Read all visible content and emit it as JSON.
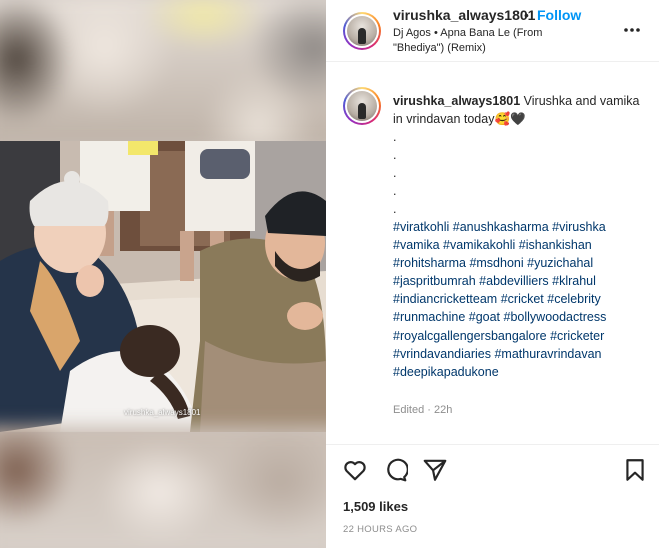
{
  "header": {
    "username": "virushka_always1801",
    "separator": "•",
    "follow_label": "Follow",
    "audio": "Dj Agos • Apna Bana Le (From \"Bhediya\") (Remix)",
    "more_icon": "more-horizontal-icon"
  },
  "media": {
    "watermark": "virushka_always1801"
  },
  "caption": {
    "username": "virushka_always1801",
    "text": "Virushka and vamika in vrindavan today🥰🖤\n.\n.\n.\n.\n.",
    "hashtags": [
      "#viratkohli",
      "#anushkasharma",
      "#virushka",
      "#vamika",
      "#vamikakohli",
      "#ishankishan",
      "#rohitsharma",
      "#msdhoni",
      "#yuzichahal",
      "#jaspritbumrah",
      "#abdevilliers",
      "#klrahul",
      "#indiancricketteam",
      "#cricket",
      "#celebrity",
      "#runmachine",
      "#goat",
      "#bollywoodactress",
      "#royalcgallengersbangalore",
      "#cricketer",
      "#vrindavandiaries",
      "#mathuravrindavan",
      "#deepikapadukone"
    ],
    "meta": "Edited · 22h"
  },
  "actions": {
    "like_icon": "heart-icon",
    "comment_icon": "comment-icon",
    "share_icon": "send-icon",
    "save_icon": "bookmark-icon",
    "likes": "1,509 likes",
    "timestamp": "22 HOURS AGO"
  },
  "colors": {
    "accent": "#0095f6",
    "hashtag": "#00376b",
    "muted": "#8e8e8e",
    "text": "#262626"
  }
}
